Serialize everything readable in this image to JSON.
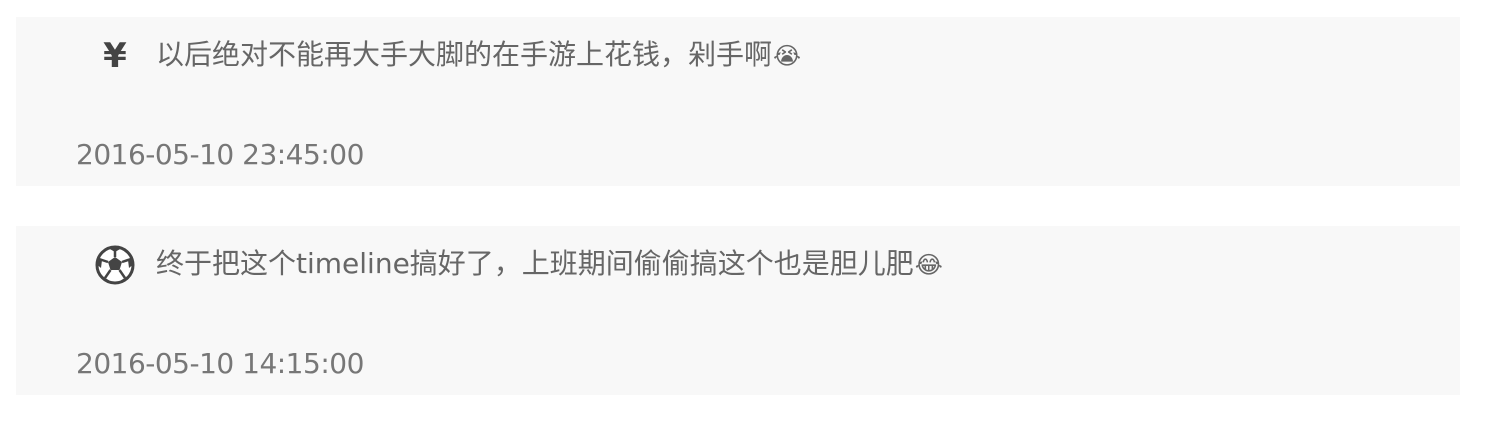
{
  "timeline": {
    "entries": [
      {
        "icon": "yen-icon",
        "icon_text": "¥",
        "text": "以后绝对不能再大手大脚的在手游上花钱，剁手啊",
        "emoji": "😭",
        "time": "2016-05-10 23:45:00"
      },
      {
        "icon": "soccer-ball-icon",
        "text": "终于把这个timeline搞好了，上班期间偷偷搞这个也是胆儿肥",
        "emoji": "😂",
        "time": "2016-05-10 14:15:00"
      }
    ]
  },
  "colors": {
    "card_background": "#f8f8f8",
    "text": "#666666",
    "icon": "#444444"
  }
}
